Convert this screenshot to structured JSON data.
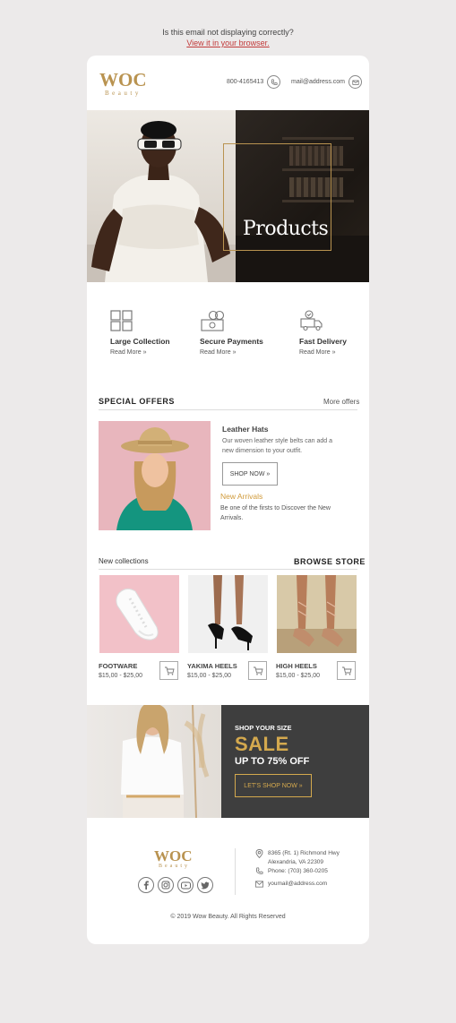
{
  "preheader": {
    "line1": "Is this email not displaying correctly?",
    "link": "View it in your browser."
  },
  "header": {
    "logo_main": "WOC",
    "logo_sub": "Beauty",
    "phone": "800-4165413",
    "email": "mail@address.com"
  },
  "hero": {
    "title": "Products"
  },
  "features": [
    {
      "title": "Large Collection",
      "link": "Read More »",
      "icon": "grid-icon"
    },
    {
      "title": "Secure Payments",
      "link": "Read More »",
      "icon": "money-icon"
    },
    {
      "title": "Fast Delivery",
      "link": "Read More »",
      "icon": "truck-icon"
    }
  ],
  "special_offers": {
    "title": "SPECIAL OFFERS",
    "more": "More offers",
    "item_title": "Leather Hats",
    "item_desc": "Our woven leather style belts can add a new dimension to your outfit.",
    "button": "SHOP NOW »",
    "new_title": "New Arrivals",
    "new_desc": "Be one of the firsts to Discover the New Arrivals."
  },
  "collections": {
    "title": "New collections",
    "link": "BROWSE STORE",
    "products": [
      {
        "name": "FOOTWARE",
        "price": "$15,00 - $25,00"
      },
      {
        "name": "YAKIMA HEELS",
        "price": "$15,00 - $25,00"
      },
      {
        "name": "HIGH HEELS",
        "price": "$15,00 - $25,00"
      }
    ]
  },
  "promo": {
    "kicker": "SHOP YOUR SIZE",
    "headline": "SALE",
    "sub": "UP TO 75% OFF",
    "button": "LET'S SHOP NOW »"
  },
  "footer": {
    "logo_main": "WOC",
    "logo_sub": "Beauty",
    "address1": "8365 (Rt. 1) Richmond Hwy",
    "address2": "Alexandria, VA 22309",
    "phone": "Phone: (703) 360-0205",
    "email": "youmail@address.com",
    "copyright": "© 2019 Wow Beauty. All Rights Reserved",
    "social": [
      "facebook-icon",
      "instagram-icon",
      "youtube-icon",
      "twitter-icon"
    ]
  },
  "colors": {
    "accent": "#b99350",
    "link_red": "#c23a3a",
    "sale_gold": "#d4a94e",
    "banner_dark": "#3e3e3e"
  }
}
